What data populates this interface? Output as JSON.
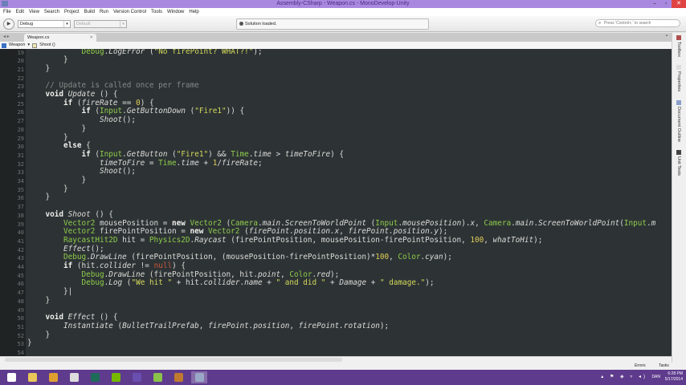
{
  "window": {
    "title": "Assembly-CSharp - Weapon.cs - MonoDevelop-Unity",
    "minimize": "‒",
    "maximize": "▫",
    "close": "✕"
  },
  "menu": [
    "File",
    "Edit",
    "View",
    "Search",
    "Project",
    "Build",
    "Run",
    "Version Control",
    "Tools",
    "Window",
    "Help"
  ],
  "toolbar": {
    "run_icon": "▶",
    "config": "Debug",
    "platform": "Default",
    "status": "Solution loaded.",
    "search_placeholder": "Press 'Control+,' to search"
  },
  "tabs": [
    {
      "label": "Weapon.cs",
      "close": "✕"
    }
  ],
  "breadcrumb": {
    "class": "Weapon",
    "sep": "▾",
    "method": "Shoot ()"
  },
  "right_pads": [
    "Toolbox",
    "Properties",
    "Document Outline",
    "Unit Tests"
  ],
  "colors": {
    "editor_bg": "#2d3335",
    "type": "#8fcc4a",
    "string": "#d4d95a",
    "number": "#e2cf5a",
    "comment": "#848a86",
    "null": "#c8553a",
    "titlebar": "#a989e0",
    "taskbar": "#5e3b8d"
  },
  "editor": {
    "first_line": 19,
    "lines": [
      [
        [
          "t",
          "            "
        ],
        [
          "g",
          "Debug"
        ],
        [
          "t",
          "."
        ],
        [
          "i",
          "LogError"
        ],
        [
          "t",
          " ("
        ],
        [
          "s",
          "\"No firePoint? WHAT?!\""
        ],
        [
          "t",
          ");"
        ]
      ],
      [
        [
          "t",
          "        }"
        ]
      ],
      [
        [
          "t",
          "    }"
        ]
      ],
      [],
      [
        [
          "c",
          "    // Update is called once per frame"
        ]
      ],
      [
        [
          "k",
          "    void "
        ],
        [
          "i",
          "Update"
        ],
        [
          "t",
          " () {"
        ]
      ],
      [
        [
          "k",
          "        if"
        ],
        [
          "t",
          " ("
        ],
        [
          "i",
          "fireRate"
        ],
        [
          "t",
          " == "
        ],
        [
          "n",
          "0"
        ],
        [
          "t",
          ") {"
        ]
      ],
      [
        [
          "k",
          "            if"
        ],
        [
          "t",
          " ("
        ],
        [
          "g",
          "Input"
        ],
        [
          "t",
          "."
        ],
        [
          "i",
          "GetButtonDown"
        ],
        [
          "t",
          " ("
        ],
        [
          "s",
          "\"Fire1\""
        ],
        [
          "t",
          ")) {"
        ]
      ],
      [
        [
          "i",
          "                Shoot"
        ],
        [
          "t",
          "();"
        ]
      ],
      [
        [
          "t",
          "            }"
        ]
      ],
      [
        [
          "t",
          "        }"
        ]
      ],
      [
        [
          "k",
          "        else"
        ],
        [
          "t",
          " {"
        ]
      ],
      [
        [
          "k",
          "            if"
        ],
        [
          "t",
          " ("
        ],
        [
          "g",
          "Input"
        ],
        [
          "t",
          "."
        ],
        [
          "i",
          "GetButton"
        ],
        [
          "t",
          " ("
        ],
        [
          "s",
          "\"Fire1\""
        ],
        [
          "t",
          ") && "
        ],
        [
          "g",
          "Time"
        ],
        [
          "t",
          "."
        ],
        [
          "i",
          "time"
        ],
        [
          "t",
          " > "
        ],
        [
          "i",
          "timeToFire"
        ],
        [
          "t",
          ") {"
        ]
      ],
      [
        [
          "i",
          "                timeToFire"
        ],
        [
          "t",
          " = "
        ],
        [
          "g",
          "Time"
        ],
        [
          "t",
          "."
        ],
        [
          "i",
          "time"
        ],
        [
          "t",
          " + "
        ],
        [
          "n",
          "1"
        ],
        [
          "t",
          "/"
        ],
        [
          "i",
          "fireRate"
        ],
        [
          "t",
          ";"
        ]
      ],
      [
        [
          "i",
          "                Shoot"
        ],
        [
          "t",
          "();"
        ]
      ],
      [
        [
          "t",
          "            }"
        ]
      ],
      [
        [
          "t",
          "        }"
        ]
      ],
      [
        [
          "t",
          "    }"
        ]
      ],
      [],
      [
        [
          "k",
          "    void "
        ],
        [
          "i",
          "Shoot"
        ],
        [
          "t",
          " () {"
        ]
      ],
      [
        [
          "g",
          "        Vector2"
        ],
        [
          "t",
          " mousePosition = "
        ],
        [
          "k",
          "new "
        ],
        [
          "g",
          "Vector2"
        ],
        [
          "t",
          " ("
        ],
        [
          "g",
          "Camera"
        ],
        [
          "t",
          "."
        ],
        [
          "i",
          "main"
        ],
        [
          "t",
          "."
        ],
        [
          "i",
          "ScreenToWorldPoint"
        ],
        [
          "t",
          " ("
        ],
        [
          "g",
          "Input"
        ],
        [
          "t",
          "."
        ],
        [
          "i",
          "mousePosition"
        ],
        [
          "t",
          ")."
        ],
        [
          "i",
          "x"
        ],
        [
          "t",
          ", "
        ],
        [
          "g",
          "Camera"
        ],
        [
          "t",
          "."
        ],
        [
          "i",
          "main"
        ],
        [
          "t",
          "."
        ],
        [
          "i",
          "ScreenToWorldPoint"
        ],
        [
          "t",
          "("
        ],
        [
          "g",
          "Input"
        ],
        [
          "t",
          "."
        ],
        [
          "i",
          "m"
        ]
      ],
      [
        [
          "g",
          "        Vector2"
        ],
        [
          "t",
          " firePointPosition = "
        ],
        [
          "k",
          "new "
        ],
        [
          "g",
          "Vector2"
        ],
        [
          "t",
          " ("
        ],
        [
          "i",
          "firePoint.position.x"
        ],
        [
          "t",
          ", "
        ],
        [
          "i",
          "firePoint.position.y"
        ],
        [
          "t",
          ");"
        ]
      ],
      [
        [
          "g",
          "        RaycastHit2D"
        ],
        [
          "t",
          " hit = "
        ],
        [
          "g",
          "Physics2D"
        ],
        [
          "t",
          "."
        ],
        [
          "i",
          "Raycast"
        ],
        [
          "t",
          " (firePointPosition, mousePosition-firePointPosition, "
        ],
        [
          "n",
          "100"
        ],
        [
          "t",
          ", "
        ],
        [
          "i",
          "whatToHit"
        ],
        [
          "t",
          ");"
        ]
      ],
      [
        [
          "i",
          "        Effect"
        ],
        [
          "t",
          "();"
        ]
      ],
      [
        [
          "g",
          "        Debug"
        ],
        [
          "t",
          "."
        ],
        [
          "i",
          "DrawLine"
        ],
        [
          "t",
          " (firePointPosition, (mousePosition-firePointPosition)*"
        ],
        [
          "n",
          "100"
        ],
        [
          "t",
          ", "
        ],
        [
          "g",
          "Color"
        ],
        [
          "t",
          "."
        ],
        [
          "i",
          "cyan"
        ],
        [
          "t",
          ");"
        ]
      ],
      [
        [
          "k",
          "        if"
        ],
        [
          "t",
          " (hit."
        ],
        [
          "i",
          "collider"
        ],
        [
          "t",
          " != "
        ],
        [
          "r",
          "null"
        ],
        [
          "t",
          ") {"
        ]
      ],
      [
        [
          "g",
          "            Debug"
        ],
        [
          "t",
          "."
        ],
        [
          "i",
          "DrawLine"
        ],
        [
          "t",
          " (firePointPosition, hit."
        ],
        [
          "i",
          "point"
        ],
        [
          "t",
          ", "
        ],
        [
          "g",
          "Color"
        ],
        [
          "t",
          "."
        ],
        [
          "i",
          "red"
        ],
        [
          "t",
          ");"
        ]
      ],
      [
        [
          "g",
          "            Debug"
        ],
        [
          "t",
          "."
        ],
        [
          "i",
          "Log"
        ],
        [
          "t",
          " ("
        ],
        [
          "s",
          "\"We hit \""
        ],
        [
          "t",
          " + hit."
        ],
        [
          "i",
          "collider"
        ],
        [
          "t",
          "."
        ],
        [
          "i",
          "name"
        ],
        [
          "t",
          " + "
        ],
        [
          "s",
          "\" and did \""
        ],
        [
          "t",
          " + "
        ],
        [
          "i",
          "Damage"
        ],
        [
          "t",
          " + "
        ],
        [
          "s",
          "\" damage.\""
        ],
        [
          "t",
          ");"
        ]
      ],
      [
        [
          "t",
          "        }|"
        ]
      ],
      [
        [
          "t",
          "    }"
        ]
      ],
      [],
      [
        [
          "k",
          "    void "
        ],
        [
          "i",
          "Effect"
        ],
        [
          "t",
          " () {"
        ]
      ],
      [
        [
          "i",
          "        Instantiate"
        ],
        [
          "t",
          " ("
        ],
        [
          "i",
          "BulletTrailPrefab"
        ],
        [
          "t",
          ", "
        ],
        [
          "i",
          "firePoint.position"
        ],
        [
          "t",
          ", "
        ],
        [
          "i",
          "firePoint.rotation"
        ],
        [
          "t",
          ");"
        ]
      ],
      [
        [
          "t",
          "    }"
        ]
      ],
      [
        [
          "t",
          "}"
        ]
      ],
      []
    ]
  },
  "statusbar": {
    "errors": "Errors",
    "tasks": "Tasks"
  },
  "taskbar": {
    "apps": [
      {
        "name": "start",
        "color": "#ffffff"
      },
      {
        "name": "file-explorer",
        "color": "#e9c65a"
      },
      {
        "name": "chrome",
        "color": "#e0a030"
      },
      {
        "name": "unity",
        "color": "#dddddd"
      },
      {
        "name": "audition",
        "color": "#1f6b5a"
      },
      {
        "name": "nvidia",
        "color": "#76b900"
      },
      {
        "name": "visual-studio",
        "color": "#6a4fb0"
      },
      {
        "name": "notepad",
        "color": "#8ac24a"
      },
      {
        "name": "media-player",
        "color": "#c07a30"
      },
      {
        "name": "monodevelop",
        "color": "#9aa8c8"
      }
    ],
    "lang": "DAN",
    "time": "6:28 PM",
    "date": "5/17/2014"
  }
}
